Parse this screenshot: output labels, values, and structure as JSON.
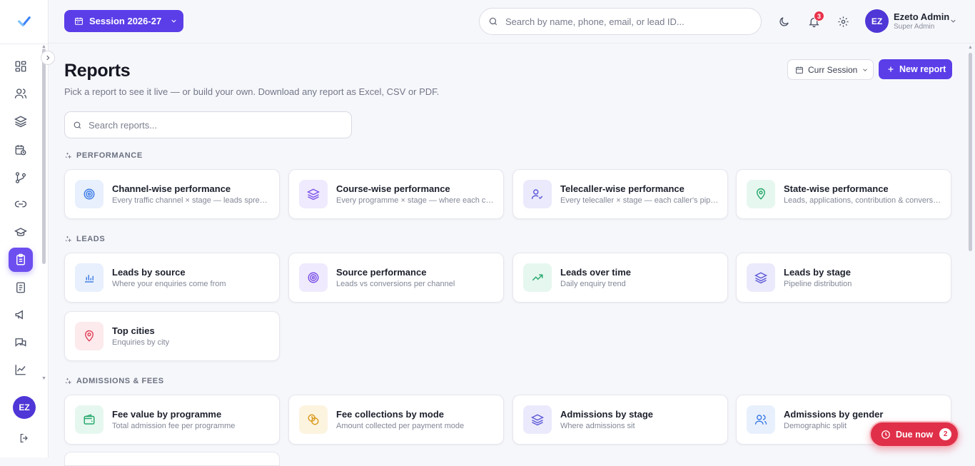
{
  "sidebar": {
    "logo": "check-logo",
    "items": [
      {
        "icon": "dashboard-icon",
        "active": false
      },
      {
        "icon": "users-icon",
        "active": false
      },
      {
        "icon": "layers-icon",
        "active": false
      },
      {
        "icon": "calendar-clock-icon",
        "active": false
      },
      {
        "icon": "git-branch-icon",
        "active": false
      },
      {
        "icon": "link-icon",
        "active": false
      },
      {
        "icon": "graduation-cap-icon",
        "active": false
      },
      {
        "icon": "clipboard-icon",
        "active": true
      },
      {
        "icon": "document-icon",
        "active": false
      },
      {
        "icon": "megaphone-icon",
        "active": false
      },
      {
        "icon": "chat-icon",
        "active": false
      },
      {
        "icon": "line-chart-icon",
        "active": false
      }
    ],
    "avatar_initials": "EZ"
  },
  "topbar": {
    "session_label": "Session 2026-27",
    "search_placeholder": "Search by name, phone, email, or lead ID...",
    "notification_count": "3",
    "user_initials": "EZ",
    "user_name": "Ezeto Admin",
    "user_role": "Super Admin"
  },
  "page": {
    "title": "Reports",
    "subtitle": "Pick a report to see it live — or build your own. Download any report as Excel, CSV or PDF.",
    "curr_session_label": "Curr Session",
    "new_report_label": "New report",
    "search_placeholder": "Search reports..."
  },
  "sections": [
    {
      "label": "PERFORMANCE",
      "cards": [
        {
          "title": "Channel-wise performance",
          "desc": "Every traffic channel × stage — leads spread across funnel",
          "icon": "target-icon",
          "color": "blue"
        },
        {
          "title": "Course-wise performance",
          "desc": "Every programme × stage — where each course converts",
          "icon": "layers-icon",
          "color": "purple"
        },
        {
          "title": "Telecaller-wise performance",
          "desc": "Every telecaller × stage — each caller's pipeline",
          "icon": "user-check-icon",
          "color": "indigo"
        },
        {
          "title": "State-wise performance",
          "desc": "Leads, applications, contribution & conversion",
          "icon": "map-pin-icon",
          "color": "green"
        }
      ]
    },
    {
      "label": "LEADS",
      "cards": [
        {
          "title": "Leads by source",
          "desc": "Where your enquiries come from",
          "icon": "bar-chart-icon",
          "color": "blue"
        },
        {
          "title": "Source performance",
          "desc": "Leads vs conversions per channel",
          "icon": "target-icon",
          "color": "purple"
        },
        {
          "title": "Leads over time",
          "desc": "Daily enquiry trend",
          "icon": "trending-up-icon",
          "color": "green"
        },
        {
          "title": "Leads by stage",
          "desc": "Pipeline distribution",
          "icon": "layers-icon",
          "color": "indigo"
        },
        {
          "title": "Top cities",
          "desc": "Enquiries by city",
          "icon": "map-pin-icon",
          "color": "red"
        }
      ]
    },
    {
      "label": "ADMISSIONS & FEES",
      "cards": [
        {
          "title": "Fee value by programme",
          "desc": "Total admission fee per programme",
          "icon": "wallet-icon",
          "color": "green"
        },
        {
          "title": "Fee collections by mode",
          "desc": "Amount collected per payment mode",
          "icon": "coins-icon",
          "color": "yellow"
        },
        {
          "title": "Admissions by stage",
          "desc": "Where admissions sit",
          "icon": "layers-icon",
          "color": "indigo"
        },
        {
          "title": "Admissions by gender",
          "desc": "Demographic split",
          "icon": "users-icon",
          "color": "blue"
        }
      ]
    }
  ],
  "due_now": {
    "label": "Due now",
    "count": "2"
  }
}
